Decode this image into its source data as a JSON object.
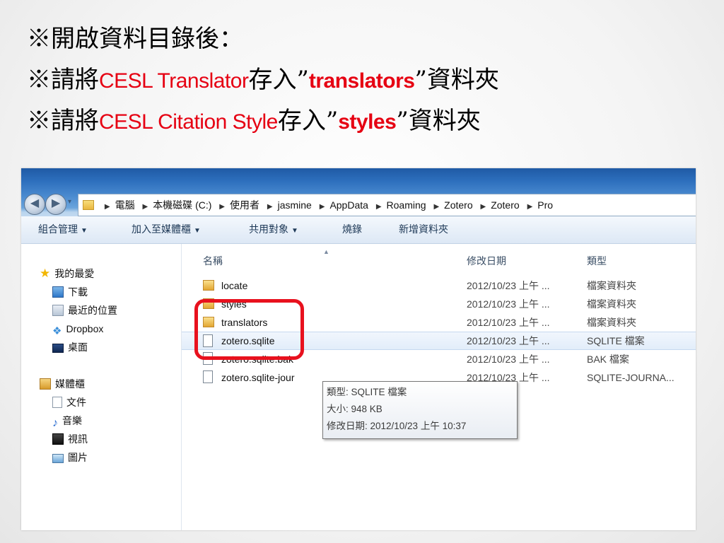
{
  "heading": {
    "line1": "※開啟資料目錄後：",
    "line2": {
      "prefix": "※請將",
      "red": "CESL Translator",
      "mid": "存入”",
      "red_bold": "translators",
      "suffix": "”資料夾"
    },
    "line3": {
      "prefix": "※請將",
      "red": "CESL Citation Style",
      "mid": "存入”",
      "red_bold": "styles",
      "suffix": "”資料夾"
    }
  },
  "breadcrumb": [
    "電腦",
    "本機磁碟 (C:)",
    "使用者",
    "jasmine",
    "AppData",
    "Roaming",
    "Zotero",
    "Zotero",
    "Pro"
  ],
  "toolbar": {
    "organize": "組合管理",
    "add_to_library": "加入至媒體櫃",
    "share": "共用對象",
    "burn": "燒錄",
    "new_folder": "新增資料夾"
  },
  "nav": {
    "favorites": "我的最愛",
    "downloads": "下載",
    "recent": "最近的位置",
    "dropbox": "Dropbox",
    "desktop": "桌面",
    "libraries": "媒體櫃",
    "documents": "文件",
    "music": "音樂",
    "videos": "視訊",
    "pictures": "圖片"
  },
  "columns": {
    "name": "名稱",
    "date": "修改日期",
    "type": "類型"
  },
  "files": [
    {
      "name": "locate",
      "date": "2012/10/23 上午 ...",
      "type": "檔案資料夾",
      "kind": "folder"
    },
    {
      "name": "styles",
      "date": "2012/10/23 上午 ...",
      "type": "檔案資料夾",
      "kind": "folder"
    },
    {
      "name": "translators",
      "date": "2012/10/23 上午 ...",
      "type": "檔案資料夾",
      "kind": "folder"
    },
    {
      "name": "zotero.sqlite",
      "date": "2012/10/23 上午 ...",
      "type": "SQLITE 檔案",
      "kind": "file"
    },
    {
      "name": "zotero.sqlite.bak",
      "date": "2012/10/23 上午 ...",
      "type": "BAK 檔案",
      "kind": "file"
    },
    {
      "name": "zotero.sqlite-jour",
      "date": "2012/10/23 上午 ...",
      "type": "SQLITE-JOURNA...",
      "kind": "file"
    }
  ],
  "tooltip": {
    "type": "類型: SQLITE 檔案",
    "size": "大小: 948 KB",
    "modified": "修改日期: 2012/10/23 上午 10:37"
  },
  "colors": {
    "highlight": "#e8111e",
    "red_text": "#e60012"
  }
}
